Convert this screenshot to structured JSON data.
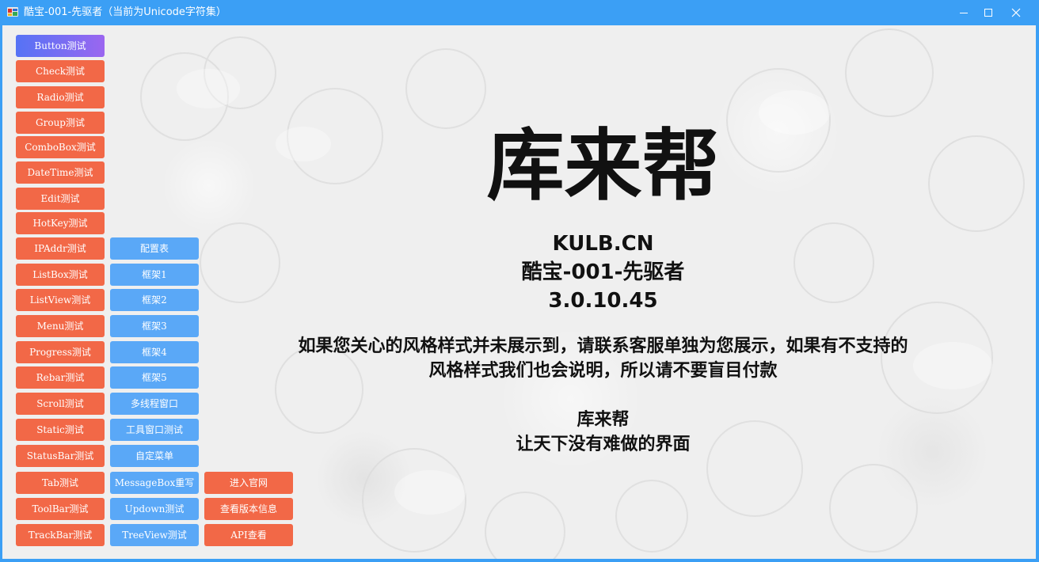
{
  "window": {
    "title": "酷宝-001-先驱者（当前为Unicode字符集）",
    "icon": "app-icon",
    "controls": {
      "minimize_icon": "minimize-icon",
      "maximize_icon": "maximize-icon",
      "close_icon": "close-icon"
    }
  },
  "colors": {
    "titlebar": "#3b9ff5",
    "button_orange": "#f26847",
    "button_blue": "#5aa8f7",
    "button_active_start": "#5673f5",
    "button_active_end": "#9b66f0",
    "text_dark": "#111111"
  },
  "buttons": {
    "col1": [
      {
        "label": "Button测试",
        "active": true
      },
      {
        "label": "Check测试"
      },
      {
        "label": "Radio测试"
      },
      {
        "label": "Group测试"
      },
      {
        "label": "ComboBox测试"
      },
      {
        "label": "DateTime测试"
      },
      {
        "label": "Edit测试"
      },
      {
        "label": "HotKey测试"
      },
      {
        "label": "IPAddr测试"
      },
      {
        "label": "ListBox测试"
      },
      {
        "label": "ListView测试"
      },
      {
        "label": "Menu测试"
      },
      {
        "label": "Progress测试"
      },
      {
        "label": "Rebar测试"
      },
      {
        "label": "Scroll测试"
      },
      {
        "label": "Static测试"
      },
      {
        "label": "StatusBar测试"
      },
      {
        "label": "Tab测试"
      },
      {
        "label": "ToolBar测试"
      },
      {
        "label": "TrackBar测试"
      }
    ],
    "col2": [
      {
        "label": "配置表"
      },
      {
        "label": "框架1"
      },
      {
        "label": "框架2"
      },
      {
        "label": "框架3"
      },
      {
        "label": "框架4"
      },
      {
        "label": "框架5"
      },
      {
        "label": "多线程窗口"
      },
      {
        "label": "工具窗口测试"
      },
      {
        "label": "自定菜单"
      },
      {
        "label": "MessageBox重写"
      },
      {
        "label": "Updown测试"
      },
      {
        "label": "TreeView测试"
      }
    ],
    "col3": [
      {
        "label": "进入官网"
      },
      {
        "label": "查看版本信息"
      },
      {
        "label": "API查看"
      }
    ]
  },
  "main": {
    "brand": "库来帮",
    "site": "KULB.CN",
    "product": "酷宝-001-先驱者",
    "version": "3.0.10.45",
    "notice_line1": "如果您关心的风格样式并未展示到，请联系客服单独为您展示，如果有不支持的",
    "notice_line2": "风格样式我们也会说明，所以请不要盲目付款",
    "slogan_line1": "库来帮",
    "slogan_line2": "让天下没有难做的界面"
  }
}
